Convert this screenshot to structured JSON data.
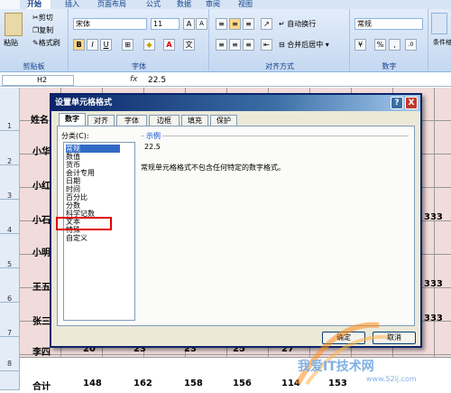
{
  "ribbon": {
    "tabs": [
      "开始",
      "插入",
      "页面布局",
      "公式",
      "数据",
      "审阅",
      "视图"
    ],
    "clipboard": {
      "paste": "粘贴",
      "cut": "剪切",
      "copy": "复制",
      "format_painter": "格式刷",
      "group": "剪贴板"
    },
    "font": {
      "name": "宋体",
      "size": "11",
      "bold": "B",
      "italic": "I",
      "underline": "U",
      "group": "字体"
    },
    "alignment": {
      "wrap": "自动换行",
      "merge": "合并后居中",
      "group": "对齐方式"
    },
    "number": {
      "format": "常规",
      "percent": "%",
      "comma": ",",
      "group": "数字"
    },
    "cells": {
      "label": "条件格"
    }
  },
  "formula_bar": {
    "cell": "H2",
    "fx": "fx",
    "value": "22.5"
  },
  "sheet": {
    "row_numbers": [
      "1",
      "2",
      "3",
      "4",
      "5",
      "6",
      "7",
      "8"
    ],
    "names": [
      "姓名",
      "小华",
      "小红",
      "小石",
      "小明",
      "王五",
      "张三",
      "李四",
      "合计"
    ],
    "right_values": [
      "333",
      "333",
      "333"
    ],
    "totals": [
      "148",
      "162",
      "158",
      "156",
      "114",
      "153"
    ],
    "li_row": [
      "20",
      "23",
      "23",
      "25",
      "27"
    ]
  },
  "dialog": {
    "title": "设置单元格格式",
    "help": "?",
    "close": "X",
    "tabs": [
      "数字",
      "对齐",
      "字体",
      "边框",
      "填充",
      "保护"
    ],
    "category_label": "分类(C):",
    "categories": [
      "常规",
      "数值",
      "货币",
      "会计专用",
      "日期",
      "时间",
      "百分比",
      "分数",
      "科学记数",
      "文本",
      "特殊",
      "自定义"
    ],
    "sample_label": "示例",
    "sample_value": "22.5",
    "description": "常规单元格格式不包含任何特定的数字格式。",
    "ok": "确定",
    "cancel": "取消"
  },
  "watermark": {
    "text": "我爱IT技术网",
    "url": "www.52ij.com"
  }
}
